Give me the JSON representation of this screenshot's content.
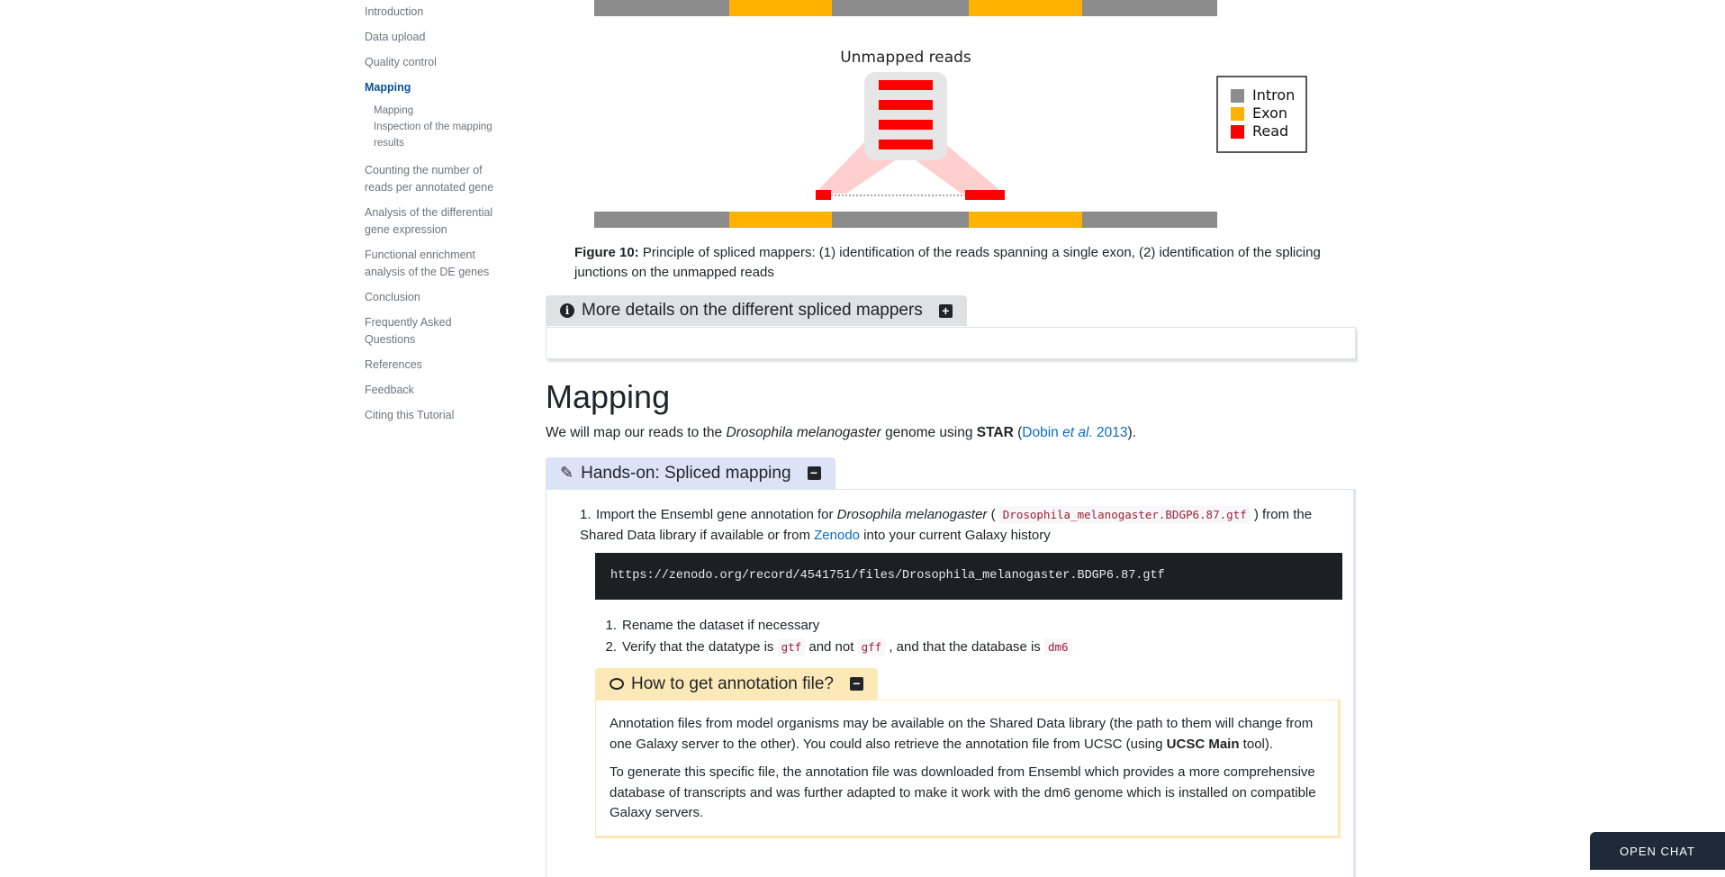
{
  "toc": {
    "items": [
      {
        "label": "Introduction"
      },
      {
        "label": "Data upload"
      },
      {
        "label": "Quality control"
      },
      {
        "label": "Mapping"
      },
      {
        "label": "Counting the number of reads per annotated gene"
      },
      {
        "label": "Analysis of the differential gene expression"
      },
      {
        "label": "Functional enrichment analysis of the DE genes"
      },
      {
        "label": "Conclusion"
      },
      {
        "label": "Frequently Asked Questions"
      },
      {
        "label": "References"
      },
      {
        "label": "Feedback"
      },
      {
        "label": "Citing this Tutorial"
      }
    ],
    "active": "Mapping",
    "sub_items": [
      {
        "label": "Mapping"
      },
      {
        "label": "Inspection of the mapping results"
      }
    ]
  },
  "figure": {
    "unmapped_label": "Unmapped reads",
    "legend": [
      {
        "label": "Intron",
        "color": "#8c8c8c"
      },
      {
        "label": "Exon",
        "color": "#ffb300"
      },
      {
        "label": "Read",
        "color": "#ff0000"
      }
    ],
    "caption_label": "Figure 10:",
    "caption_text": "Principle of spliced mappers: (1) identification of the reads spanning a single exon, (2) identification of the splicing junctions on the unmapped reads"
  },
  "details_box": {
    "title": "More details on the different spliced mappers",
    "toggle": "+"
  },
  "section": {
    "title": "Mapping",
    "intro_before": "We will map our reads to the ",
    "intro_species": "Drosophila melanogaster",
    "intro_middle": " genome using ",
    "intro_tool": "STAR",
    "intro_open": " (",
    "intro_cite_author": "Dobin",
    "intro_cite_etal": "et al.",
    "intro_cite_year": "2013",
    "intro_close": ")."
  },
  "hands_on": {
    "title": "Hands-on: Spliced mapping",
    "toggle": "−",
    "step_number": "1.",
    "step_text_1": "Import the Ensembl gene annotation for ",
    "step_species": "Drosophila melanogaster",
    "step_text_2": " ( ",
    "step_filename": "Drosophila_melanogaster.BDGP6.87.gtf",
    "step_text_3": " ) from the Shared Data library if available or from ",
    "step_link": "Zenodo",
    "step_text_4": " into your current Galaxy history",
    "code_url": "https://zenodo.org/record/4541751/files/Drosophila_melanogaster.BDGP6.87.gtf",
    "sub1_num": "1.",
    "sub1_text": "Rename the dataset if necessary",
    "sub2_num": "2.",
    "sub2_a": "Verify that the datatype is ",
    "sub2_code1": "gtf",
    "sub2_b": " and not ",
    "sub2_code2": "gff",
    "sub2_c": " , and that the database is ",
    "sub2_code3": "dm6"
  },
  "tip": {
    "title": "How to get annotation file?",
    "toggle": "−",
    "p1_a": "Annotation files from model organisms may be available on the Shared Data library (the path to them will change from one Galaxy server to the other). You could also retrieve the annotation file from UCSC (using ",
    "p1_bold": "UCSC Main",
    "p1_b": " tool).",
    "p2": "To generate this specific file, the annotation file was downloaded from Ensembl which provides a more comprehensive database of transcripts and was further adapted to make it work with the dm6 genome which is installed on compatible Galaxy servers."
  },
  "chat": {
    "label": "OPEN CHAT"
  }
}
